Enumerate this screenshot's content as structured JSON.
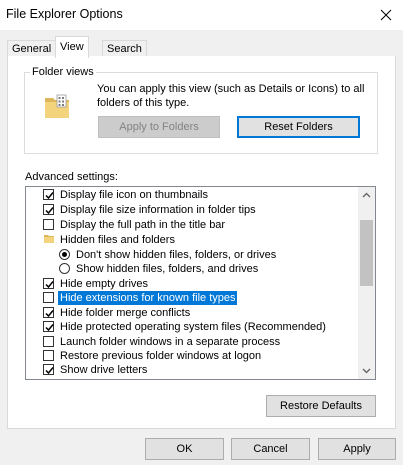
{
  "window": {
    "title": "File Explorer Options"
  },
  "tabs": [
    {
      "label": "General"
    },
    {
      "label": "View"
    },
    {
      "label": "Search"
    }
  ],
  "folder_views": {
    "label": "Folder views",
    "description": "You can apply this view (such as Details or Icons) to all folders of this type.",
    "apply_label": "Apply to Folders",
    "reset_label": "Reset Folders"
  },
  "advanced": {
    "label": "Advanced settings:",
    "items": [
      {
        "label": "Display file icon on thumbnails",
        "kind": "checkbox",
        "checked": true
      },
      {
        "label": "Display file size information in folder tips",
        "kind": "checkbox",
        "checked": true
      },
      {
        "label": "Display the full path in the title bar",
        "kind": "checkbox",
        "checked": false
      },
      {
        "label": "Hidden files and folders",
        "kind": "folder"
      },
      {
        "label": "Don't show hidden files, folders, or drives",
        "kind": "radio",
        "checked": true
      },
      {
        "label": "Show hidden files, folders, and drives",
        "kind": "radio",
        "checked": false
      },
      {
        "label": "Hide empty drives",
        "kind": "checkbox",
        "checked": true
      },
      {
        "label": "Hide extensions for known file types",
        "kind": "checkbox",
        "checked": false,
        "selected": true
      },
      {
        "label": "Hide folder merge conflicts",
        "kind": "checkbox",
        "checked": true
      },
      {
        "label": "Hide protected operating system files (Recommended)",
        "kind": "checkbox",
        "checked": true
      },
      {
        "label": "Launch folder windows in a separate process",
        "kind": "checkbox",
        "checked": false
      },
      {
        "label": "Restore previous folder windows at logon",
        "kind": "checkbox",
        "checked": false
      },
      {
        "label": "Show drive letters",
        "kind": "checkbox",
        "checked": true
      }
    ]
  },
  "restore_defaults_label": "Restore Defaults",
  "footer": {
    "ok_label": "OK",
    "cancel_label": "Cancel",
    "apply_label": "Apply"
  }
}
